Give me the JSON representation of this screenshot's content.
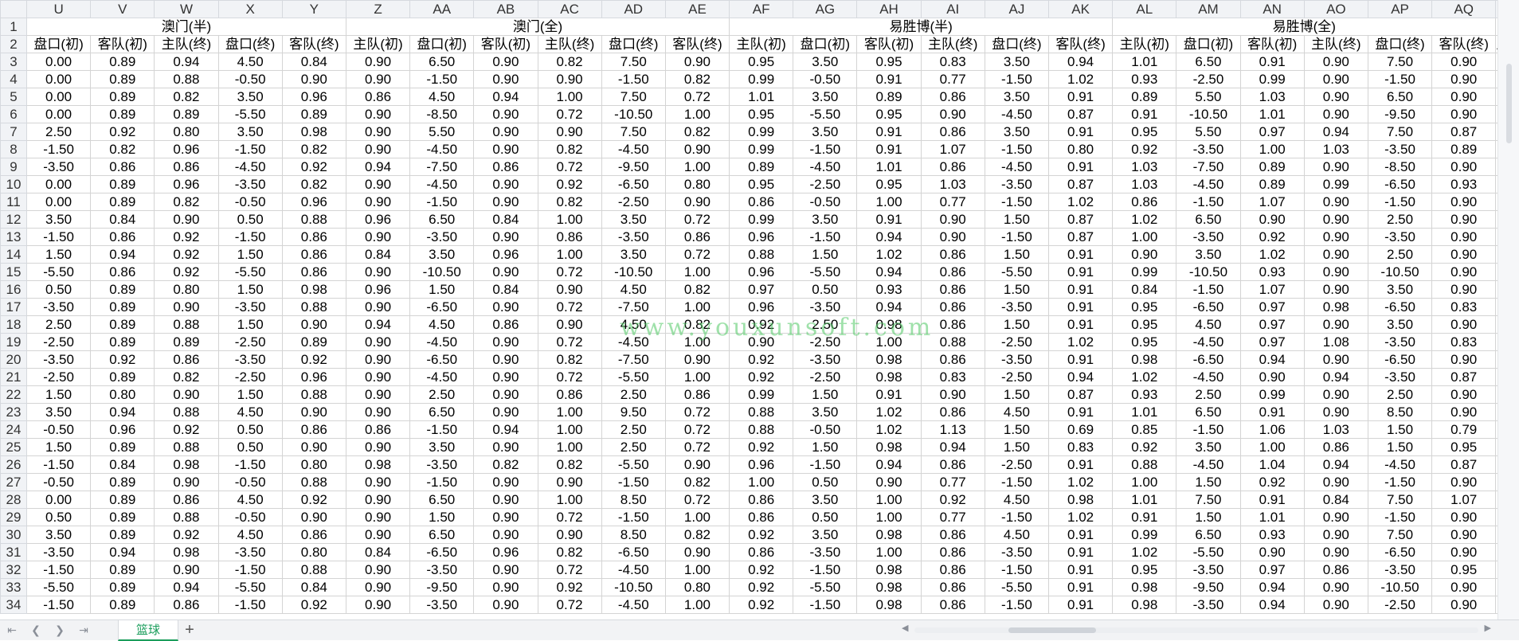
{
  "columns": [
    "U",
    "V",
    "W",
    "X",
    "Y",
    "Z",
    "AA",
    "AB",
    "AC",
    "AD",
    "AE",
    "AF",
    "AG",
    "AH",
    "AI",
    "AJ",
    "AK",
    "AL",
    "AM",
    "AN",
    "AO",
    "AP",
    "AQ"
  ],
  "group_headers": [
    {
      "label": "澳门(半)",
      "span": 5
    },
    {
      "label": "澳门(全)",
      "span": 6
    },
    {
      "label": "易胜博(半)",
      "span": 6
    },
    {
      "label": "易胜博(全)",
      "span": 6
    }
  ],
  "sub_headers": [
    "盘口(初)",
    "客队(初)",
    "主队(终)",
    "盘口(终)",
    "客队(终)",
    "主队(初)",
    "盘口(初)",
    "客队(初)",
    "主队(终)",
    "盘口(终)",
    "客队(终)",
    "主队(初)",
    "盘口(初)",
    "客队(初)",
    "主队(终)",
    "盘口(终)",
    "客队(终)",
    "主队(初)",
    "盘口(初)",
    "客队(初)",
    "主队(终)",
    "盘口(终)",
    "客队(终)"
  ],
  "overflow_header": "主",
  "rows": [
    {
      "n": "3",
      "cells": [
        "0.00",
        "0.89",
        "0.94",
        "4.50",
        "0.84",
        "0.90",
        "6.50",
        "0.90",
        "0.82",
        "7.50",
        "0.90",
        "0.95",
        "3.50",
        "0.95",
        "0.83",
        "3.50",
        "0.94",
        "1.01",
        "6.50",
        "0.91",
        "0.90",
        "7.50",
        "0.90"
      ]
    },
    {
      "n": "4",
      "cells": [
        "0.00",
        "0.89",
        "0.88",
        "-0.50",
        "0.90",
        "0.90",
        "-1.50",
        "0.90",
        "0.90",
        "-1.50",
        "0.82",
        "0.99",
        "-0.50",
        "0.91",
        "0.77",
        "-1.50",
        "1.02",
        "0.93",
        "-2.50",
        "0.99",
        "0.90",
        "-1.50",
        "0.90"
      ]
    },
    {
      "n": "5",
      "cells": [
        "0.00",
        "0.89",
        "0.82",
        "3.50",
        "0.96",
        "0.86",
        "4.50",
        "0.94",
        "1.00",
        "7.50",
        "0.72",
        "1.01",
        "3.50",
        "0.89",
        "0.86",
        "3.50",
        "0.91",
        "0.89",
        "5.50",
        "1.03",
        "0.90",
        "6.50",
        "0.90"
      ]
    },
    {
      "n": "6",
      "cells": [
        "0.00",
        "0.89",
        "0.89",
        "-5.50",
        "0.89",
        "0.90",
        "-8.50",
        "0.90",
        "0.72",
        "-10.50",
        "1.00",
        "0.95",
        "-5.50",
        "0.95",
        "0.90",
        "-4.50",
        "0.87",
        "0.91",
        "-10.50",
        "1.01",
        "0.90",
        "-9.50",
        "0.90"
      ]
    },
    {
      "n": "7",
      "cells": [
        "2.50",
        "0.92",
        "0.80",
        "3.50",
        "0.98",
        "0.90",
        "5.50",
        "0.90",
        "0.90",
        "7.50",
        "0.82",
        "0.99",
        "3.50",
        "0.91",
        "0.86",
        "3.50",
        "0.91",
        "0.95",
        "5.50",
        "0.97",
        "0.94",
        "7.50",
        "0.87"
      ]
    },
    {
      "n": "8",
      "cells": [
        "-1.50",
        "0.82",
        "0.96",
        "-1.50",
        "0.82",
        "0.90",
        "-4.50",
        "0.90",
        "0.82",
        "-4.50",
        "0.90",
        "0.99",
        "-1.50",
        "0.91",
        "1.07",
        "-1.50",
        "0.80",
        "0.92",
        "-3.50",
        "1.00",
        "1.03",
        "-3.50",
        "0.89"
      ]
    },
    {
      "n": "9",
      "cells": [
        "-3.50",
        "0.86",
        "0.86",
        "-4.50",
        "0.92",
        "0.94",
        "-7.50",
        "0.86",
        "0.72",
        "-9.50",
        "1.00",
        "0.89",
        "-4.50",
        "1.01",
        "0.86",
        "-4.50",
        "0.91",
        "1.03",
        "-7.50",
        "0.89",
        "0.90",
        "-8.50",
        "0.90"
      ]
    },
    {
      "n": "10",
      "cells": [
        "0.00",
        "0.89",
        "0.96",
        "-3.50",
        "0.82",
        "0.90",
        "-4.50",
        "0.90",
        "0.92",
        "-6.50",
        "0.80",
        "0.95",
        "-2.50",
        "0.95",
        "1.03",
        "-3.50",
        "0.87",
        "1.03",
        "-4.50",
        "0.89",
        "0.99",
        "-6.50",
        "0.93"
      ]
    },
    {
      "n": "11",
      "cells": [
        "0.00",
        "0.89",
        "0.82",
        "-0.50",
        "0.96",
        "0.90",
        "-1.50",
        "0.90",
        "0.82",
        "-2.50",
        "0.90",
        "0.86",
        "-0.50",
        "1.00",
        "0.77",
        "-1.50",
        "1.02",
        "0.86",
        "-1.50",
        "1.07",
        "0.90",
        "-1.50",
        "0.90"
      ]
    },
    {
      "n": "12",
      "cells": [
        "3.50",
        "0.84",
        "0.90",
        "0.50",
        "0.88",
        "0.96",
        "6.50",
        "0.84",
        "1.00",
        "3.50",
        "0.72",
        "0.99",
        "3.50",
        "0.91",
        "0.90",
        "1.50",
        "0.87",
        "1.02",
        "6.50",
        "0.90",
        "0.90",
        "2.50",
        "0.90"
      ]
    },
    {
      "n": "13",
      "cells": [
        "-1.50",
        "0.86",
        "0.92",
        "-1.50",
        "0.86",
        "0.90",
        "-3.50",
        "0.90",
        "0.86",
        "-3.50",
        "0.86",
        "0.96",
        "-1.50",
        "0.94",
        "0.90",
        "-1.50",
        "0.87",
        "1.00",
        "-3.50",
        "0.92",
        "0.90",
        "-3.50",
        "0.90"
      ]
    },
    {
      "n": "14",
      "cells": [
        "1.50",
        "0.94",
        "0.92",
        "1.50",
        "0.86",
        "0.84",
        "3.50",
        "0.96",
        "1.00",
        "3.50",
        "0.72",
        "0.88",
        "1.50",
        "1.02",
        "0.86",
        "1.50",
        "0.91",
        "0.90",
        "3.50",
        "1.02",
        "0.90",
        "2.50",
        "0.90"
      ]
    },
    {
      "n": "15",
      "cells": [
        "-5.50",
        "0.86",
        "0.92",
        "-5.50",
        "0.86",
        "0.90",
        "-10.50",
        "0.90",
        "0.72",
        "-10.50",
        "1.00",
        "0.96",
        "-5.50",
        "0.94",
        "0.86",
        "-5.50",
        "0.91",
        "0.99",
        "-10.50",
        "0.93",
        "0.90",
        "-10.50",
        "0.90"
      ]
    },
    {
      "n": "16",
      "cells": [
        "0.50",
        "0.89",
        "0.80",
        "1.50",
        "0.98",
        "0.96",
        "1.50",
        "0.84",
        "0.90",
        "4.50",
        "0.82",
        "0.97",
        "0.50",
        "0.93",
        "0.86",
        "1.50",
        "0.91",
        "0.84",
        "-1.50",
        "1.07",
        "0.90",
        "3.50",
        "0.90"
      ]
    },
    {
      "n": "17",
      "cells": [
        "-3.50",
        "0.89",
        "0.90",
        "-3.50",
        "0.88",
        "0.90",
        "-6.50",
        "0.90",
        "0.72",
        "-7.50",
        "1.00",
        "0.96",
        "-3.50",
        "0.94",
        "0.86",
        "-3.50",
        "0.91",
        "0.95",
        "-6.50",
        "0.97",
        "0.98",
        "-6.50",
        "0.83"
      ]
    },
    {
      "n": "18",
      "cells": [
        "2.50",
        "0.89",
        "0.88",
        "1.50",
        "0.90",
        "0.94",
        "4.50",
        "0.86",
        "0.90",
        "4.50",
        "0.82",
        "0.92",
        "2.50",
        "0.98",
        "0.86",
        "1.50",
        "0.91",
        "0.95",
        "4.50",
        "0.97",
        "0.90",
        "3.50",
        "0.90"
      ]
    },
    {
      "n": "19",
      "cells": [
        "-2.50",
        "0.89",
        "0.89",
        "-2.50",
        "0.89",
        "0.90",
        "-4.50",
        "0.90",
        "0.72",
        "-4.50",
        "1.00",
        "0.90",
        "-2.50",
        "1.00",
        "0.88",
        "-2.50",
        "1.02",
        "0.95",
        "-4.50",
        "0.97",
        "1.08",
        "-3.50",
        "0.83"
      ]
    },
    {
      "n": "20",
      "cells": [
        "-3.50",
        "0.92",
        "0.86",
        "-3.50",
        "0.92",
        "0.90",
        "-6.50",
        "0.90",
        "0.82",
        "-7.50",
        "0.90",
        "0.92",
        "-3.50",
        "0.98",
        "0.86",
        "-3.50",
        "0.91",
        "0.98",
        "-6.50",
        "0.94",
        "0.90",
        "-6.50",
        "0.90"
      ]
    },
    {
      "n": "21",
      "cells": [
        "-2.50",
        "0.89",
        "0.82",
        "-2.50",
        "0.96",
        "0.90",
        "-4.50",
        "0.90",
        "0.72",
        "-5.50",
        "1.00",
        "0.92",
        "-2.50",
        "0.98",
        "0.83",
        "-2.50",
        "0.94",
        "1.02",
        "-4.50",
        "0.90",
        "0.94",
        "-3.50",
        "0.87"
      ]
    },
    {
      "n": "22",
      "cells": [
        "1.50",
        "0.80",
        "0.90",
        "1.50",
        "0.88",
        "0.90",
        "2.50",
        "0.90",
        "0.86",
        "2.50",
        "0.86",
        "0.99",
        "1.50",
        "0.91",
        "0.90",
        "1.50",
        "0.87",
        "0.93",
        "2.50",
        "0.99",
        "0.90",
        "2.50",
        "0.90"
      ]
    },
    {
      "n": "23",
      "cells": [
        "3.50",
        "0.94",
        "0.88",
        "4.50",
        "0.90",
        "0.90",
        "6.50",
        "0.90",
        "1.00",
        "9.50",
        "0.72",
        "0.88",
        "3.50",
        "1.02",
        "0.86",
        "4.50",
        "0.91",
        "1.01",
        "6.50",
        "0.91",
        "0.90",
        "8.50",
        "0.90"
      ]
    },
    {
      "n": "24",
      "cells": [
        "-0.50",
        "0.96",
        "0.92",
        "0.50",
        "0.86",
        "0.86",
        "-1.50",
        "0.94",
        "1.00",
        "2.50",
        "0.72",
        "0.88",
        "-0.50",
        "1.02",
        "1.13",
        "1.50",
        "0.69",
        "0.85",
        "-1.50",
        "1.06",
        "1.03",
        "1.50",
        "0.79"
      ]
    },
    {
      "n": "25",
      "cells": [
        "1.50",
        "0.89",
        "0.88",
        "0.50",
        "0.90",
        "0.90",
        "3.50",
        "0.90",
        "1.00",
        "2.50",
        "0.72",
        "0.92",
        "1.50",
        "0.98",
        "0.94",
        "1.50",
        "0.83",
        "0.92",
        "3.50",
        "1.00",
        "0.86",
        "1.50",
        "0.95"
      ]
    },
    {
      "n": "26",
      "cells": [
        "-1.50",
        "0.84",
        "0.98",
        "-1.50",
        "0.80",
        "0.98",
        "-3.50",
        "0.82",
        "0.82",
        "-5.50",
        "0.90",
        "0.96",
        "-1.50",
        "0.94",
        "0.86",
        "-2.50",
        "0.91",
        "0.88",
        "-4.50",
        "1.04",
        "0.94",
        "-4.50",
        "0.87"
      ]
    },
    {
      "n": "27",
      "cells": [
        "-0.50",
        "0.89",
        "0.90",
        "-0.50",
        "0.88",
        "0.90",
        "-1.50",
        "0.90",
        "0.90",
        "-1.50",
        "0.82",
        "1.00",
        "0.50",
        "0.90",
        "0.77",
        "-1.50",
        "1.02",
        "1.00",
        "1.50",
        "0.92",
        "0.90",
        "-1.50",
        "0.90"
      ]
    },
    {
      "n": "28",
      "cells": [
        "0.00",
        "0.89",
        "0.86",
        "4.50",
        "0.92",
        "0.90",
        "6.50",
        "0.90",
        "1.00",
        "8.50",
        "0.72",
        "0.86",
        "3.50",
        "1.00",
        "0.92",
        "4.50",
        "0.98",
        "1.01",
        "7.50",
        "0.91",
        "0.84",
        "7.50",
        "1.07"
      ]
    },
    {
      "n": "29",
      "cells": [
        "0.50",
        "0.89",
        "0.88",
        "-0.50",
        "0.90",
        "0.90",
        "1.50",
        "0.90",
        "0.72",
        "-1.50",
        "1.00",
        "0.86",
        "0.50",
        "1.00",
        "0.77",
        "-1.50",
        "1.02",
        "0.91",
        "1.50",
        "1.01",
        "0.90",
        "-1.50",
        "0.90"
      ]
    },
    {
      "n": "30",
      "cells": [
        "3.50",
        "0.89",
        "0.92",
        "4.50",
        "0.86",
        "0.90",
        "6.50",
        "0.90",
        "0.90",
        "8.50",
        "0.82",
        "0.92",
        "3.50",
        "0.98",
        "0.86",
        "4.50",
        "0.91",
        "0.99",
        "6.50",
        "0.93",
        "0.90",
        "7.50",
        "0.90"
      ]
    },
    {
      "n": "31",
      "cells": [
        "-3.50",
        "0.94",
        "0.98",
        "-3.50",
        "0.80",
        "0.84",
        "-6.50",
        "0.96",
        "0.82",
        "-6.50",
        "0.90",
        "0.86",
        "-3.50",
        "1.00",
        "0.86",
        "-3.50",
        "0.91",
        "1.02",
        "-5.50",
        "0.90",
        "0.90",
        "-6.50",
        "0.90"
      ]
    },
    {
      "n": "32",
      "cells": [
        "-1.50",
        "0.89",
        "0.90",
        "-1.50",
        "0.88",
        "0.90",
        "-3.50",
        "0.90",
        "0.72",
        "-4.50",
        "1.00",
        "0.92",
        "-1.50",
        "0.98",
        "0.86",
        "-1.50",
        "0.91",
        "0.95",
        "-3.50",
        "0.97",
        "0.86",
        "-3.50",
        "0.95"
      ]
    },
    {
      "n": "33",
      "cells": [
        "-5.50",
        "0.89",
        "0.94",
        "-5.50",
        "0.84",
        "0.90",
        "-9.50",
        "0.90",
        "0.92",
        "-10.50",
        "0.80",
        "0.92",
        "-5.50",
        "0.98",
        "0.86",
        "-5.50",
        "0.91",
        "0.98",
        "-9.50",
        "0.94",
        "0.90",
        "-10.50",
        "0.90"
      ]
    },
    {
      "n": "34",
      "cells": [
        "-1.50",
        "0.89",
        "0.86",
        "-1.50",
        "0.92",
        "0.90",
        "-3.50",
        "0.90",
        "0.72",
        "-4.50",
        "1.00",
        "0.92",
        "-1.50",
        "0.98",
        "0.86",
        "-1.50",
        "0.91",
        "0.98",
        "-3.50",
        "0.94",
        "0.90",
        "-2.50",
        "0.90"
      ]
    }
  ],
  "row_labels_fixed": [
    "1",
    "2"
  ],
  "sheet_tab": "篮球",
  "watermark": "www.youxunsoft.com",
  "nav": {
    "first": "first-sheet-icon",
    "prev": "prev-sheet-icon",
    "next": "next-sheet-icon",
    "last": "last-sheet-icon"
  },
  "accent_color": "#1a9d5b"
}
